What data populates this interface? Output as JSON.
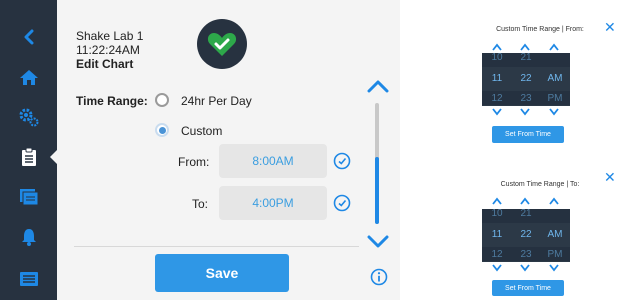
{
  "sidebar": {
    "items": [
      {
        "icon": "chevron-left-icon"
      },
      {
        "icon": "home-icon"
      },
      {
        "icon": "settings-gears-icon"
      },
      {
        "icon": "clipboard-icon",
        "active": true
      },
      {
        "icon": "folders-icon"
      },
      {
        "icon": "bell-icon"
      },
      {
        "icon": "list-icon"
      }
    ],
    "bg_color": "#273240",
    "icon_color": "#1e88e5"
  },
  "header": {
    "device_name": "Shake Lab 1",
    "time": "11:22:24AM",
    "section": "Edit Chart"
  },
  "status_icon": "heart-check-icon",
  "status_color": "#2da84a",
  "time_range": {
    "label": "Time Range:",
    "options": [
      {
        "label": "24hr Per Day",
        "selected": false
      },
      {
        "label": "Custom",
        "selected": true
      }
    ],
    "from": {
      "label": "From:",
      "value": "8:00AM"
    },
    "to": {
      "label": "To:",
      "value": "4:00PM"
    }
  },
  "save_label": "Save",
  "popup_from": {
    "title": "Custom Time Range | From:",
    "columns": [
      {
        "above": "10",
        "selected": "11",
        "below": "12"
      },
      {
        "above": "21",
        "selected": "22",
        "below": "23"
      },
      {
        "above": "",
        "selected": "AM",
        "below": "PM"
      }
    ],
    "button_label": "Set From Time"
  },
  "popup_to": {
    "title": "Custom Time Range | To:",
    "columns": [
      {
        "above": "10",
        "selected": "11",
        "below": "12"
      },
      {
        "above": "21",
        "selected": "22",
        "below": "23"
      },
      {
        "above": "",
        "selected": "AM",
        "below": "PM"
      }
    ],
    "button_label": "Set From Time"
  },
  "accent_color": "#1e88e5"
}
